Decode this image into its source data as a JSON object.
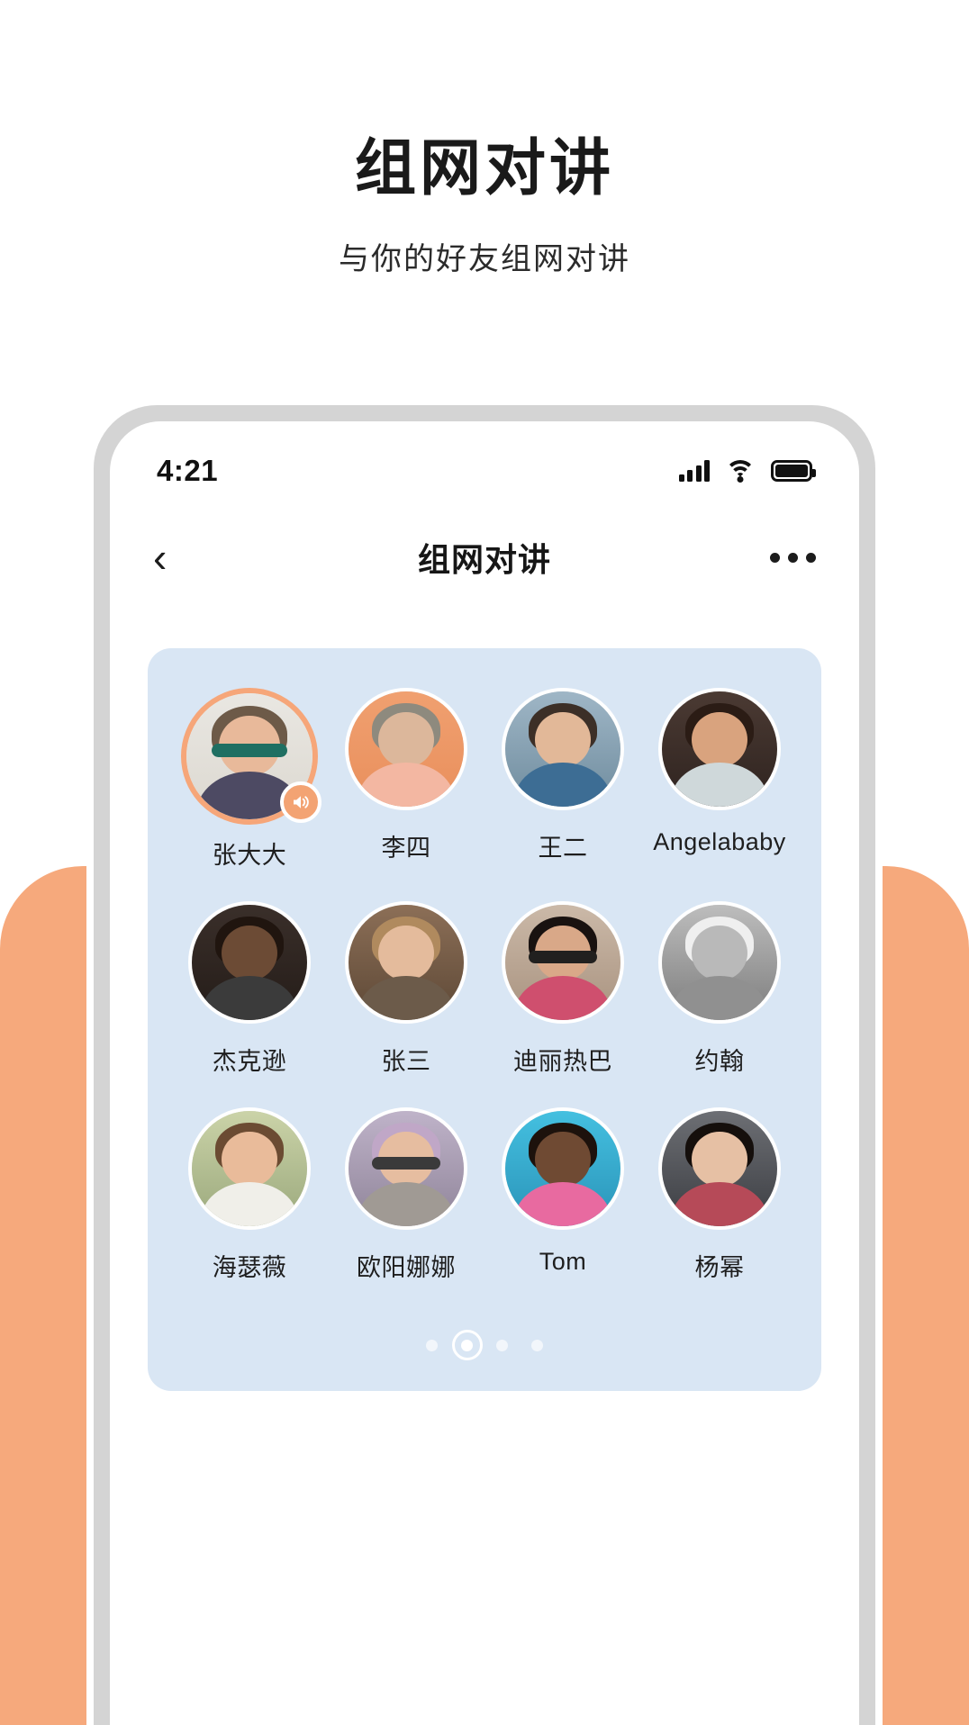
{
  "promo": {
    "title": "组网对讲",
    "subtitle": "与你的好友组网对讲"
  },
  "colors": {
    "orange_backdrop": "#F6A97C",
    "card_background": "#D9E6F4",
    "active_ring": "#F6A679",
    "phone_frame": "#D4D4D4",
    "screen": "#FFFFFF",
    "text_primary": "#1A1A1A"
  },
  "phone": {
    "status_bar": {
      "time": "4:21",
      "icons": [
        "signal-icon",
        "wifi-icon",
        "battery-icon"
      ],
      "battery_full": true
    },
    "nav_bar": {
      "back_icon": "chevron-left-icon",
      "back_glyph": "‹",
      "title": "组网对讲",
      "more_icon": "more-horizontal-icon"
    },
    "members": [
      {
        "name": "张大大",
        "active": true,
        "badge": "speaker-icon"
      },
      {
        "name": "李四",
        "active": false,
        "badge": null
      },
      {
        "name": "王二",
        "active": false,
        "badge": null
      },
      {
        "name": "Angelababy",
        "active": false,
        "badge": null
      },
      {
        "name": "杰克逊",
        "active": false,
        "badge": null
      },
      {
        "name": "张三",
        "active": false,
        "badge": null
      },
      {
        "name": "迪丽热巴",
        "active": false,
        "badge": null
      },
      {
        "name": "约翰",
        "active": false,
        "badge": null
      },
      {
        "name": "海瑟薇",
        "active": false,
        "badge": null
      },
      {
        "name": "欧阳娜娜",
        "active": false,
        "badge": null
      },
      {
        "name": "Tom",
        "active": false,
        "badge": null
      },
      {
        "name": "杨幂",
        "active": false,
        "badge": null
      }
    ],
    "pagination": {
      "total": 4,
      "current": 2
    }
  }
}
